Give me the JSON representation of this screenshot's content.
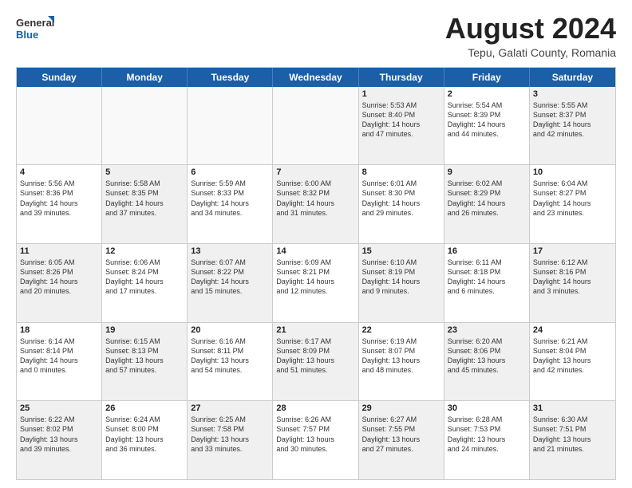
{
  "logo": {
    "general": "General",
    "blue": "Blue"
  },
  "title": "August 2024",
  "location": "Tepu, Galati County, Romania",
  "days": [
    "Sunday",
    "Monday",
    "Tuesday",
    "Wednesday",
    "Thursday",
    "Friday",
    "Saturday"
  ],
  "weeks": [
    [
      {
        "day": "",
        "text": "",
        "empty": true
      },
      {
        "day": "",
        "text": "",
        "empty": true
      },
      {
        "day": "",
        "text": "",
        "empty": true
      },
      {
        "day": "",
        "text": "",
        "empty": true
      },
      {
        "day": "1",
        "text": "Sunrise: 5:53 AM\nSunset: 8:40 PM\nDaylight: 14 hours\nand 47 minutes.",
        "shaded": true
      },
      {
        "day": "2",
        "text": "Sunrise: 5:54 AM\nSunset: 8:39 PM\nDaylight: 14 hours\nand 44 minutes.",
        "shaded": false
      },
      {
        "day": "3",
        "text": "Sunrise: 5:55 AM\nSunset: 8:37 PM\nDaylight: 14 hours\nand 42 minutes.",
        "shaded": true
      }
    ],
    [
      {
        "day": "4",
        "text": "Sunrise: 5:56 AM\nSunset: 8:36 PM\nDaylight: 14 hours\nand 39 minutes.",
        "shaded": false
      },
      {
        "day": "5",
        "text": "Sunrise: 5:58 AM\nSunset: 8:35 PM\nDaylight: 14 hours\nand 37 minutes.",
        "shaded": true
      },
      {
        "day": "6",
        "text": "Sunrise: 5:59 AM\nSunset: 8:33 PM\nDaylight: 14 hours\nand 34 minutes.",
        "shaded": false
      },
      {
        "day": "7",
        "text": "Sunrise: 6:00 AM\nSunset: 8:32 PM\nDaylight: 14 hours\nand 31 minutes.",
        "shaded": true
      },
      {
        "day": "8",
        "text": "Sunrise: 6:01 AM\nSunset: 8:30 PM\nDaylight: 14 hours\nand 29 minutes.",
        "shaded": false
      },
      {
        "day": "9",
        "text": "Sunrise: 6:02 AM\nSunset: 8:29 PM\nDaylight: 14 hours\nand 26 minutes.",
        "shaded": true
      },
      {
        "day": "10",
        "text": "Sunrise: 6:04 AM\nSunset: 8:27 PM\nDaylight: 14 hours\nand 23 minutes.",
        "shaded": false
      }
    ],
    [
      {
        "day": "11",
        "text": "Sunrise: 6:05 AM\nSunset: 8:26 PM\nDaylight: 14 hours\nand 20 minutes.",
        "shaded": true
      },
      {
        "day": "12",
        "text": "Sunrise: 6:06 AM\nSunset: 8:24 PM\nDaylight: 14 hours\nand 17 minutes.",
        "shaded": false
      },
      {
        "day": "13",
        "text": "Sunrise: 6:07 AM\nSunset: 8:22 PM\nDaylight: 14 hours\nand 15 minutes.",
        "shaded": true
      },
      {
        "day": "14",
        "text": "Sunrise: 6:09 AM\nSunset: 8:21 PM\nDaylight: 14 hours\nand 12 minutes.",
        "shaded": false
      },
      {
        "day": "15",
        "text": "Sunrise: 6:10 AM\nSunset: 8:19 PM\nDaylight: 14 hours\nand 9 minutes.",
        "shaded": true
      },
      {
        "day": "16",
        "text": "Sunrise: 6:11 AM\nSunset: 8:18 PM\nDaylight: 14 hours\nand 6 minutes.",
        "shaded": false
      },
      {
        "day": "17",
        "text": "Sunrise: 6:12 AM\nSunset: 8:16 PM\nDaylight: 14 hours\nand 3 minutes.",
        "shaded": true
      }
    ],
    [
      {
        "day": "18",
        "text": "Sunrise: 6:14 AM\nSunset: 8:14 PM\nDaylight: 14 hours\nand 0 minutes.",
        "shaded": false
      },
      {
        "day": "19",
        "text": "Sunrise: 6:15 AM\nSunset: 8:13 PM\nDaylight: 13 hours\nand 57 minutes.",
        "shaded": true
      },
      {
        "day": "20",
        "text": "Sunrise: 6:16 AM\nSunset: 8:11 PM\nDaylight: 13 hours\nand 54 minutes.",
        "shaded": false
      },
      {
        "day": "21",
        "text": "Sunrise: 6:17 AM\nSunset: 8:09 PM\nDaylight: 13 hours\nand 51 minutes.",
        "shaded": true
      },
      {
        "day": "22",
        "text": "Sunrise: 6:19 AM\nSunset: 8:07 PM\nDaylight: 13 hours\nand 48 minutes.",
        "shaded": false
      },
      {
        "day": "23",
        "text": "Sunrise: 6:20 AM\nSunset: 8:06 PM\nDaylight: 13 hours\nand 45 minutes.",
        "shaded": true
      },
      {
        "day": "24",
        "text": "Sunrise: 6:21 AM\nSunset: 8:04 PM\nDaylight: 13 hours\nand 42 minutes.",
        "shaded": false
      }
    ],
    [
      {
        "day": "25",
        "text": "Sunrise: 6:22 AM\nSunset: 8:02 PM\nDaylight: 13 hours\nand 39 minutes.",
        "shaded": true
      },
      {
        "day": "26",
        "text": "Sunrise: 6:24 AM\nSunset: 8:00 PM\nDaylight: 13 hours\nand 36 minutes.",
        "shaded": false
      },
      {
        "day": "27",
        "text": "Sunrise: 6:25 AM\nSunset: 7:58 PM\nDaylight: 13 hours\nand 33 minutes.",
        "shaded": true
      },
      {
        "day": "28",
        "text": "Sunrise: 6:26 AM\nSunset: 7:57 PM\nDaylight: 13 hours\nand 30 minutes.",
        "shaded": false
      },
      {
        "day": "29",
        "text": "Sunrise: 6:27 AM\nSunset: 7:55 PM\nDaylight: 13 hours\nand 27 minutes.",
        "shaded": true
      },
      {
        "day": "30",
        "text": "Sunrise: 6:28 AM\nSunset: 7:53 PM\nDaylight: 13 hours\nand 24 minutes.",
        "shaded": false
      },
      {
        "day": "31",
        "text": "Sunrise: 6:30 AM\nSunset: 7:51 PM\nDaylight: 13 hours\nand 21 minutes.",
        "shaded": true
      }
    ]
  ]
}
